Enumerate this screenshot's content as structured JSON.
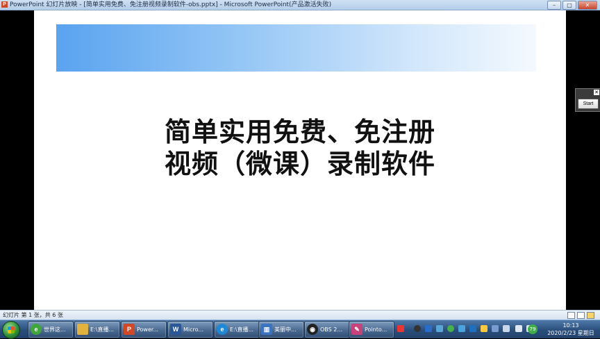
{
  "window": {
    "app_icon": "P",
    "title": "PowerPoint 幻灯片放映 - [简单实用免费、免注册视频录制软件-obs.pptx] - Microsoft PowerPoint(产品激活失败)",
    "buttons": {
      "minimize": "–",
      "restore": "□",
      "close": "✕"
    }
  },
  "slide": {
    "line1": "简单实用免费、免注册",
    "line2": "视频（微课）录制软件"
  },
  "widget": {
    "close": "✕",
    "start_label": "Start"
  },
  "statusbar": {
    "slide_info": "幻灯片 第 1 张，共 6 张"
  },
  "taskbar": {
    "items": [
      {
        "label": "世界这...",
        "icon": "browser-icon",
        "color": "#3fa73a"
      },
      {
        "label": "E:\\直播...",
        "icon": "folder-icon",
        "color": "#e1b33d"
      },
      {
        "label": "Power...",
        "icon": "powerpoint-icon",
        "color": "#d24726"
      },
      {
        "label": "Micro...",
        "icon": "word-icon",
        "color": "#2b5797"
      },
      {
        "label": "E:\\直播...",
        "icon": "ie-icon",
        "color": "#1e88d6"
      },
      {
        "label": "美丽中...",
        "icon": "chart-app-icon",
        "color": "#3a73c1"
      },
      {
        "label": "OBS 2...",
        "icon": "obs-icon",
        "color": "#222222"
      },
      {
        "label": "Pointo...",
        "icon": "pointofix-icon",
        "color": "#c7417a"
      }
    ],
    "tray": {
      "badge": "79",
      "time": "10:13",
      "date": "2020/2/23 星期日"
    }
  },
  "colors": {
    "band_start": "#5aa3ef",
    "taskbar": "#2a4e7c",
    "titlebar": "#b4cde9"
  }
}
